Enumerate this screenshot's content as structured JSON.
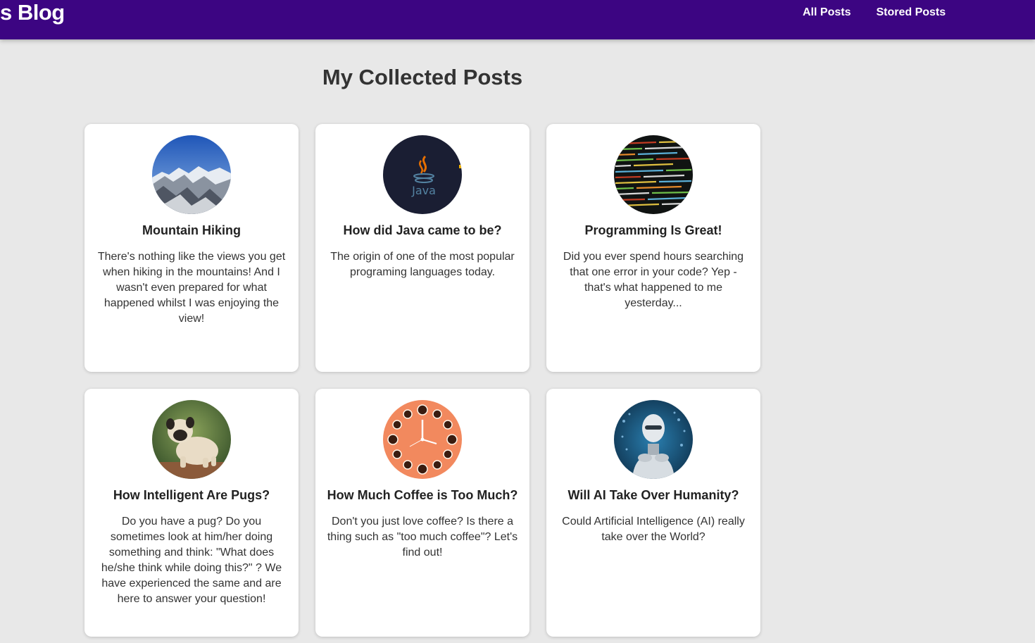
{
  "header": {
    "brand": "s Blog",
    "nav": [
      {
        "label": "All Posts"
      },
      {
        "label": "Stored Posts"
      }
    ]
  },
  "main": {
    "title": "My Collected Posts"
  },
  "posts": [
    {
      "title": "Mountain Hiking",
      "excerpt": "There's nothing like the views you get when hiking in the mountains! And I wasn't even prepared for what happened whilst I was enjoying the view!",
      "image": "mountains-image"
    },
    {
      "title": "How did Java came to be?",
      "excerpt": "The origin of one of the most popular programing languages today.",
      "image": "java-logo-image"
    },
    {
      "title": "Programming Is Great!",
      "excerpt": "Did you ever spend hours searching that one error in your code? Yep - that's what happened to me yesterday...",
      "image": "code-screen-image"
    },
    {
      "title": "How Intelligent Are Pugs?",
      "excerpt": "Do you have a pug? Do you sometimes look at him/her doing something and think: \"What does he/she think while doing this?\" ? We have experienced the same and are here to answer your question!",
      "image": "pug-image"
    },
    {
      "title": "How Much Coffee is Too Much?",
      "excerpt": "Don't you just love coffee? Is there a thing such as \"too much coffee\"? Let's find out!",
      "image": "coffee-clock-image"
    },
    {
      "title": "Will AI Take Over Humanity?",
      "excerpt": "Could Artificial Intelligence (AI) really take over the World?",
      "image": "robot-image"
    }
  ],
  "images": {
    "java_logo_text": "Java"
  },
  "colors": {
    "header_bg": "#3c0582",
    "page_bg": "#e8e8e8",
    "card_bg": "#ffffff"
  }
}
